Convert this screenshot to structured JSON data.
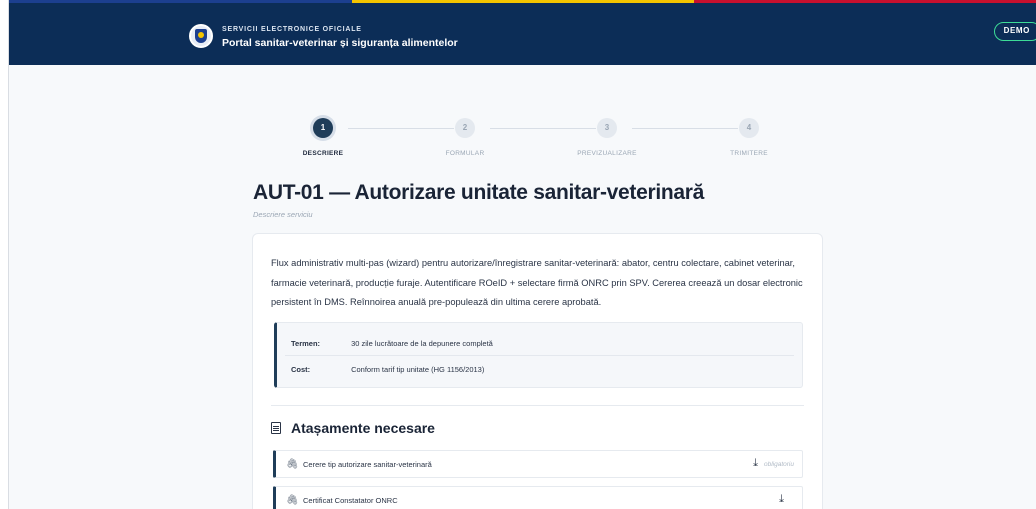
{
  "header": {
    "org": "SERVICII ELECTRONICE OFICIALE",
    "portal": "Portal sanitar-veterinar și siguranța alimentelor",
    "demo_badge": "DEMO"
  },
  "stepper": [
    {
      "num": "1",
      "label": "DESCRIERE",
      "active": true
    },
    {
      "num": "2",
      "label": "FORMULAR",
      "active": false
    },
    {
      "num": "3",
      "label": "PREVIZUALIZARE",
      "active": false
    },
    {
      "num": "4",
      "label": "TRIMITERE",
      "active": false
    }
  ],
  "page": {
    "title": "AUT-01 — Autorizare unitate sanitar-veterinară",
    "subtitle": "Descriere serviciu"
  },
  "description": "Flux administrativ multi-pas (wizard) pentru autorizare/înregistrare sanitar-veterinară: abator, centru colectare, cabinet veterinar, farmacie veterinară, producție furaje. Autentificare ROeID + selectare firmă ONRC prin SPV. Cererea creează un dosar electronic persistent în DMS. Reînnoirea anuală pre-populează din ultima cerere aprobată.",
  "info": {
    "term_label": "Termen:",
    "term_value": "30 zile lucrătoare de la depunere completă",
    "cost_label": "Cost:",
    "cost_value": "Conform tarif tip unitate (HG 1156/2013)"
  },
  "attachments": {
    "title": "Atașamente necesare",
    "items": [
      {
        "name": "Cerere tip autorizare sanitar-veterinară",
        "required_label": "obligatoriu"
      },
      {
        "name": "Certificat Constatator ONRC",
        "required_label": ""
      }
    ]
  },
  "icons": {
    "logo": "romanian-coat-of-arms-icon",
    "attachments_header": "document-icon",
    "attachment_item": "paperclip-icon",
    "download": "download-icon"
  },
  "colors": {
    "header_bg": "#0c2d57",
    "primary": "#1f3d59",
    "demo_border": "#3ddc97"
  }
}
